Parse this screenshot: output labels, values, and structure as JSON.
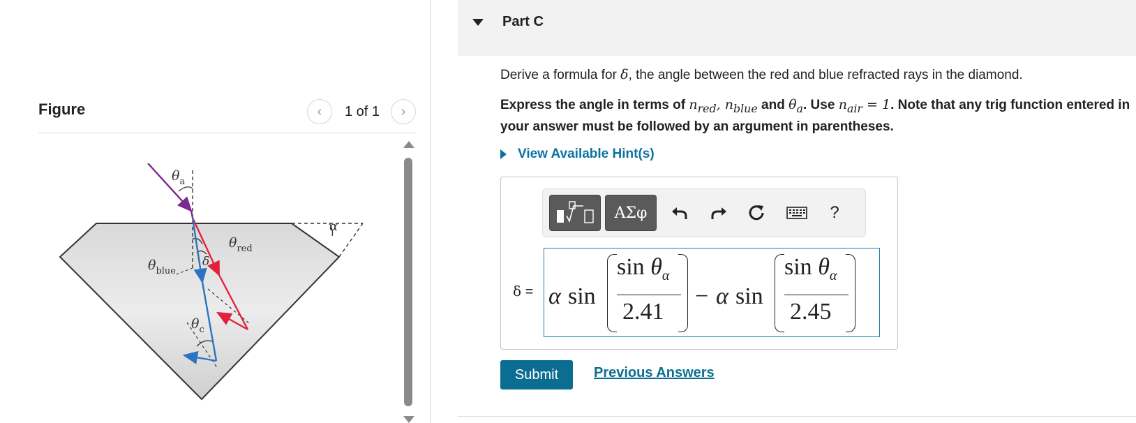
{
  "figure_panel": {
    "title": "Figure",
    "pager_text": "1 of 1",
    "prev_icon": "chevron-left-icon",
    "next_icon": "chevron-right-icon",
    "diagram_labels": {
      "theta_a": "θ",
      "theta_a_sub": "a",
      "alpha": "α",
      "theta_red": "θ",
      "theta_red_sub": "red",
      "theta_blue": "θ",
      "theta_blue_sub": "blue",
      "delta": "δ",
      "theta_c": "θ",
      "theta_c_sub": "c"
    },
    "colors": {
      "incident": "#7b2a8e",
      "red_ray": "#e3203b",
      "blue_ray": "#2a74c0"
    }
  },
  "question": {
    "part_title": "Part C",
    "prompt_before": "Derive a formula for ",
    "prompt_symbol": "δ",
    "prompt_after": ", the angle between the red and blue refracted rays in the diamond.",
    "instr_1": "Express the angle in terms of ",
    "instr_n": "n",
    "instr_red_sub": "red",
    "instr_comma": ", ",
    "instr_n2": "n",
    "instr_blue_sub": "blue",
    "instr_and": " and ",
    "instr_theta": "θ",
    "instr_a_sub": "a",
    "instr_use": ". Use ",
    "instr_n3": "n",
    "instr_air_sub": "air",
    "instr_eq": " = 1",
    "instr_rest": ". Note that any trig function entered in your answer must be followed by an argument in parentheses.",
    "hint_label": "View Available Hint(s)"
  },
  "toolbar": {
    "symbols_label": "ΑΣφ",
    "templates_icon": "templates-icon",
    "undo_icon": "undo-icon",
    "redo_icon": "redo-icon",
    "reset_icon": "reset-icon",
    "keyboard_icon": "keyboard-icon",
    "help_label": "?"
  },
  "answer": {
    "variable": "δ",
    "equals": " =",
    "term1_alpha": "α",
    "term1_sin": "sin",
    "term1_num_sin": "sin",
    "term1_num_theta": "θ",
    "term1_num_sub": "α",
    "term1_den": "2.41",
    "minus": "−",
    "term2_alpha": "α",
    "term2_sin": "sin",
    "term2_num_sin": "sin",
    "term2_num_theta": "θ",
    "term2_num_sub": "α",
    "term2_den": "2.45"
  },
  "actions": {
    "submit_label": "Submit",
    "previous_answers_label": "Previous Answers"
  },
  "accent_color": "#0b6d91"
}
